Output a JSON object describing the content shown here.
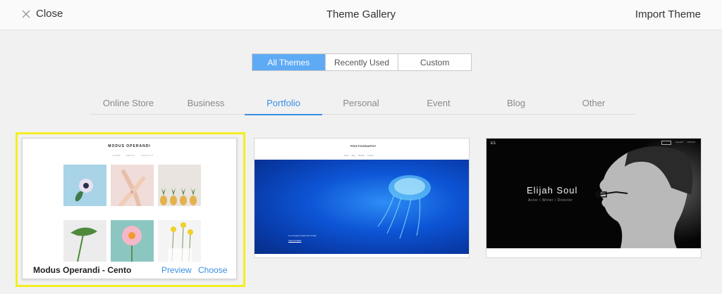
{
  "topbar": {
    "close_label": "Close",
    "title": "Theme Gallery",
    "import_label": "Import Theme"
  },
  "filters": [
    "All Themes",
    "Recently Used",
    "Custom"
  ],
  "filter_active": "All Themes",
  "categories": [
    "Online Store",
    "Business",
    "Portfolio",
    "Personal",
    "Event",
    "Blog",
    "Other"
  ],
  "category_active": "Portfolio",
  "themes": [
    {
      "name": "Modus Operandi - Cento",
      "preview_label": "Preview",
      "choose_label": "Choose",
      "brand": "MODUS OPERANDI",
      "nav": [
        "HOME",
        "ABOUT",
        "CONTACT"
      ],
      "selected": true
    },
    {
      "brand": "PHOTOGRAPHY",
      "nav": [
        "Home",
        "Blog",
        "Portfolio",
        "Contact"
      ],
      "caption": "Los Angeles based film studio",
      "link": "View Portfolio"
    },
    {
      "badge": "ES",
      "nav": [
        "GALLERY",
        "CONTACT"
      ],
      "headline": "Elijah Soul",
      "subtitle": "Actor / Writer / Director"
    }
  ],
  "colors": {
    "accent": "#3a8ee6",
    "segment_active": "#5eaaf5",
    "highlight": "#f3ee20",
    "background": "#f1f1f1"
  },
  "icons": {
    "close": "close-icon"
  }
}
